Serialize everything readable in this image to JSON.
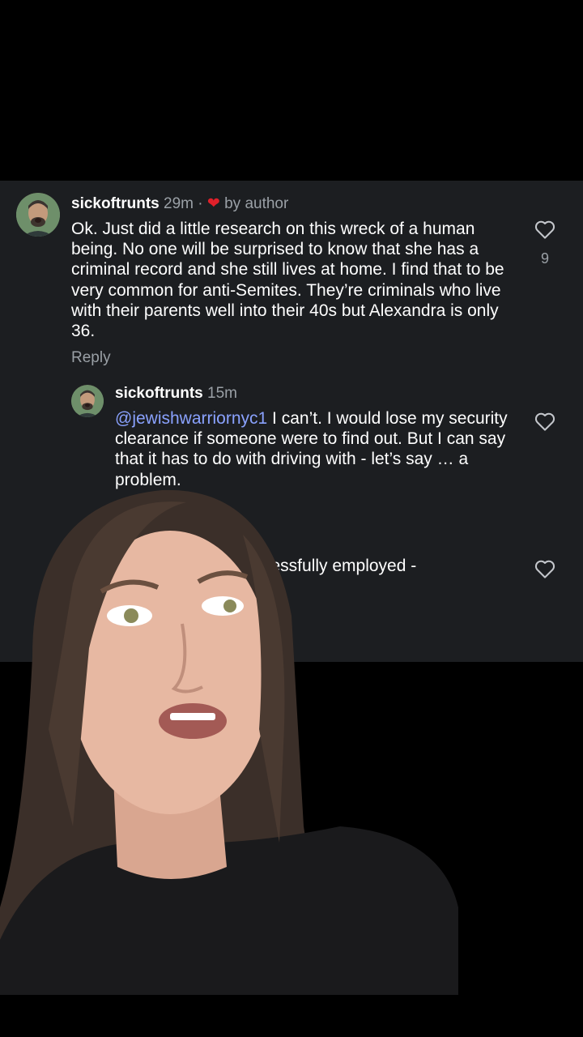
{
  "comments": [
    {
      "username": "sickoftrunts",
      "time": "29m",
      "separator": "·",
      "author_like_label": "by author",
      "text": "Ok. Just did a little research on this wreck of a human being. No one will be surprised to know that she has a criminal record and she still lives at home. I find that to be very common for anti-Semites. They’re criminals who live with their parents well into their 40s but Alexandra is only 36.",
      "reply_label": "Reply",
      "like_count": "9"
    }
  ],
  "replies": [
    {
      "username": "sickoftrunts",
      "time": "15m",
      "mention": "@jewishwarriornyc1",
      "text": " I can’t. I would lose my security clearance if someone were to find out. But I can say that it has to do with driving with - let’s say … a problem."
    }
  ],
  "obscured_reply_partial": "cessfully employed -",
  "icons": {
    "like": "heart-outline-icon",
    "author_like": "heart-filled-icon"
  },
  "colors": {
    "panel_bg": "#1c1e21",
    "mention": "#8aa2ff",
    "author_heart": "#e0202a",
    "muted_text": "#9aa0a6"
  }
}
